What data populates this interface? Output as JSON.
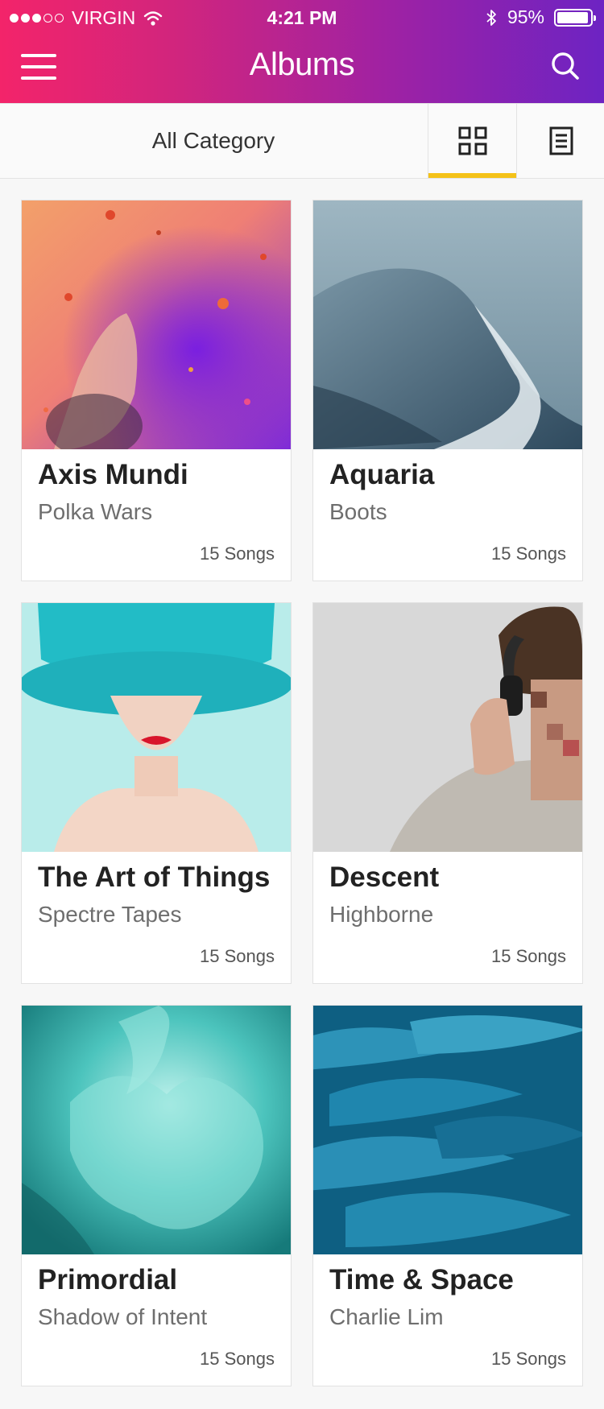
{
  "status": {
    "carrier": "VIRGIN",
    "time": "4:21 PM",
    "battery": "95%",
    "battery_level": 0.95,
    "signal_bars": 3,
    "signal_total": 5
  },
  "header": {
    "title": "Albums"
  },
  "tabs": {
    "category": "All Category",
    "active_view": "grid"
  },
  "colors": {
    "gradient_start": "#f3246a",
    "gradient_end": "#6d23c3",
    "active_tab": "#f4c219"
  },
  "albums": [
    {
      "title": "Axis Mundi",
      "artist": "Polka Wars",
      "songs": "15 Songs"
    },
    {
      "title": "Aquaria",
      "artist": "Boots",
      "songs": "15 Songs"
    },
    {
      "title": "The Art of Things",
      "artist": "Spectre Tapes",
      "songs": "15 Songs"
    },
    {
      "title": "Descent",
      "artist": "Highborne",
      "songs": "15 Songs"
    },
    {
      "title": "Primordial",
      "artist": "Shadow of Intent",
      "songs": "15 Songs"
    },
    {
      "title": "Time & Space",
      "artist": "Charlie Lim",
      "songs": "15 Songs"
    }
  ]
}
